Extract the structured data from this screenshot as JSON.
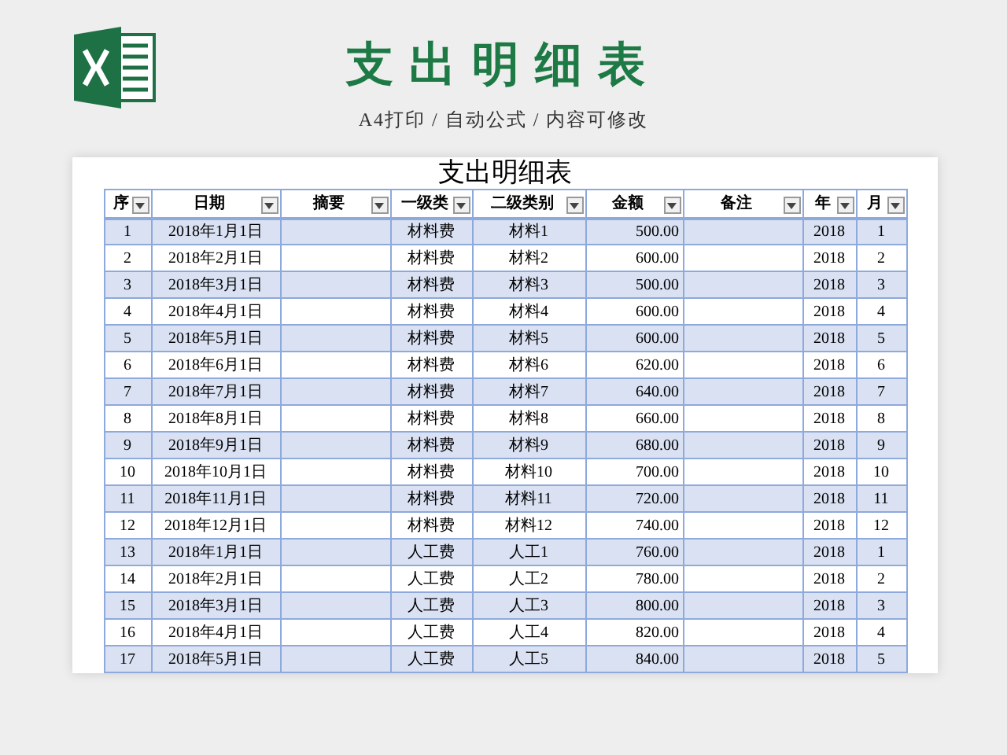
{
  "header": {
    "title": "支出明细表",
    "subtitle": "A4打印 / 自动公式 / 内容可修改"
  },
  "sheet": {
    "title": "支出明细表",
    "columns": [
      {
        "label": "序",
        "filter": true
      },
      {
        "label": "日期",
        "filter": true
      },
      {
        "label": "摘要",
        "filter": true
      },
      {
        "label": "一级类",
        "filter": true
      },
      {
        "label": "二级类别",
        "filter": true
      },
      {
        "label": "金额",
        "filter": true
      },
      {
        "label": "备注",
        "filter": true
      },
      {
        "label": "年",
        "filter": true
      },
      {
        "label": "月",
        "filter": true
      }
    ],
    "rows": [
      [
        "1",
        "2018年1月1日",
        "",
        "材料费",
        "材料1",
        "500.00",
        "",
        "2018",
        "1"
      ],
      [
        "2",
        "2018年2月1日",
        "",
        "材料费",
        "材料2",
        "600.00",
        "",
        "2018",
        "2"
      ],
      [
        "3",
        "2018年3月1日",
        "",
        "材料费",
        "材料3",
        "500.00",
        "",
        "2018",
        "3"
      ],
      [
        "4",
        "2018年4月1日",
        "",
        "材料费",
        "材料4",
        "600.00",
        "",
        "2018",
        "4"
      ],
      [
        "5",
        "2018年5月1日",
        "",
        "材料费",
        "材料5",
        "600.00",
        "",
        "2018",
        "5"
      ],
      [
        "6",
        "2018年6月1日",
        "",
        "材料费",
        "材料6",
        "620.00",
        "",
        "2018",
        "6"
      ],
      [
        "7",
        "2018年7月1日",
        "",
        "材料费",
        "材料7",
        "640.00",
        "",
        "2018",
        "7"
      ],
      [
        "8",
        "2018年8月1日",
        "",
        "材料费",
        "材料8",
        "660.00",
        "",
        "2018",
        "8"
      ],
      [
        "9",
        "2018年9月1日",
        "",
        "材料费",
        "材料9",
        "680.00",
        "",
        "2018",
        "9"
      ],
      [
        "10",
        "2018年10月1日",
        "",
        "材料费",
        "材料10",
        "700.00",
        "",
        "2018",
        "10"
      ],
      [
        "11",
        "2018年11月1日",
        "",
        "材料费",
        "材料11",
        "720.00",
        "",
        "2018",
        "11"
      ],
      [
        "12",
        "2018年12月1日",
        "",
        "材料费",
        "材料12",
        "740.00",
        "",
        "2018",
        "12"
      ],
      [
        "13",
        "2018年1月1日",
        "",
        "人工费",
        "人工1",
        "760.00",
        "",
        "2018",
        "1"
      ],
      [
        "14",
        "2018年2月1日",
        "",
        "人工费",
        "人工2",
        "780.00",
        "",
        "2018",
        "2"
      ],
      [
        "15",
        "2018年3月1日",
        "",
        "人工费",
        "人工3",
        "800.00",
        "",
        "2018",
        "3"
      ],
      [
        "16",
        "2018年4月1日",
        "",
        "人工费",
        "人工4",
        "820.00",
        "",
        "2018",
        "4"
      ],
      [
        "17",
        "2018年5月1日",
        "",
        "人工费",
        "人工5",
        "840.00",
        "",
        "2018",
        "5"
      ]
    ]
  }
}
